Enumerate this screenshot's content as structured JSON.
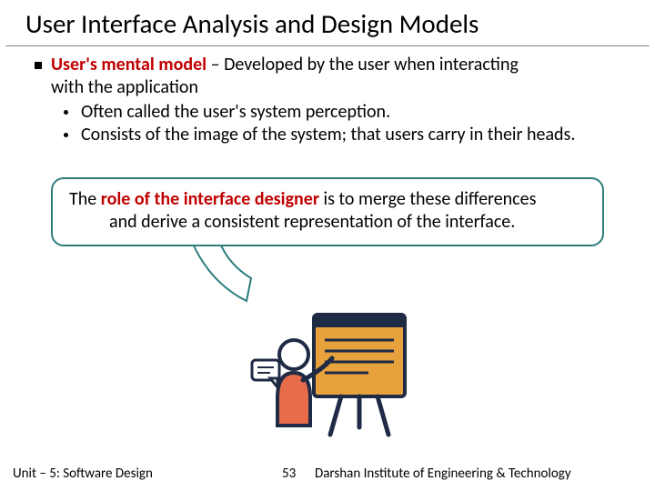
{
  "title": "User Interface Analysis and Design Models",
  "bullet": {
    "term": "User's mental model",
    "sep": " – ",
    "desc_line1": "Developed by the user when interacting",
    "desc_line2": "with the application",
    "subs": [
      "Often called the user's system perception.",
      "Consists of the image of the system; that users carry in their heads."
    ]
  },
  "callout": {
    "pre": "The ",
    "role": "role of the interface designer",
    "rest_line1": " is to merge these differences",
    "rest_line2": "and derive a consistent representation of the interface."
  },
  "footer": {
    "unit": "Unit – 5: Software Design",
    "page": "53",
    "institute": "Darshan Institute of Engineering & Technology"
  }
}
